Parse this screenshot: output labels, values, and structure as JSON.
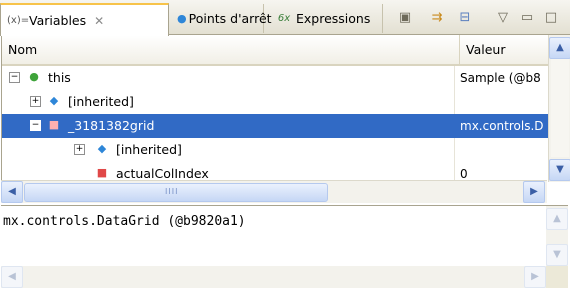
{
  "tabs": [
    {
      "label": "Variables",
      "icon": "variables-icon",
      "glyph": "(x)=",
      "active": true
    },
    {
      "label": "Points d'arrêt",
      "icon": "breakpoints-icon",
      "glyph": "●"
    },
    {
      "label": "Expressions",
      "icon": "expressions-icon",
      "glyph": "6x"
    }
  ],
  "toolbar": {
    "close_glyph": "✕",
    "buttons": [
      {
        "icon": "show-type-names-icon",
        "glyph": "▣"
      },
      {
        "icon": "collapse-all-icon",
        "glyph": "⇉"
      },
      {
        "icon": "toggle-details-pane-icon",
        "glyph": "⊟"
      },
      {
        "icon": "view-menu-icon",
        "glyph": "▽"
      },
      {
        "icon": "minimize-icon",
        "glyph": "▭"
      },
      {
        "icon": "maximize-icon",
        "glyph": "□"
      }
    ]
  },
  "table": {
    "columns": {
      "name": "Nom",
      "value": "Valeur"
    },
    "rows": [
      {
        "toggle": "⊟",
        "icon": "green-dot-icon",
        "glyph": "●",
        "name": "this",
        "value": "Sample (@b8",
        "indent": 0
      },
      {
        "toggle": "⊞",
        "icon": "blue-diamond-icon",
        "glyph": "◆",
        "name": "[inherited]",
        "value": "",
        "indent": 1
      },
      {
        "toggle": "⊟",
        "icon": "red-square-icon",
        "glyph": "■",
        "name": "_3181382grid",
        "value": "mx.controls.D",
        "indent": 1,
        "selected": true
      },
      {
        "toggle": "⊞",
        "icon": "blue-diamond-icon",
        "glyph": "◆",
        "name": "[inherited]",
        "value": "",
        "indent": 2
      },
      {
        "toggle": "",
        "icon": "red-square-icon",
        "glyph": "■",
        "name": "actualColIndex",
        "value": "0",
        "indent": 2
      }
    ]
  },
  "scroll": {
    "up": "▲",
    "down": "▼",
    "left": "◀",
    "right": "▶",
    "grip": "IIII"
  },
  "details": {
    "text": "mx.controls.DataGrid (@b9820a1)"
  },
  "colors": {
    "selection": "#316ac5",
    "tab_accent": "#f7c34a"
  }
}
